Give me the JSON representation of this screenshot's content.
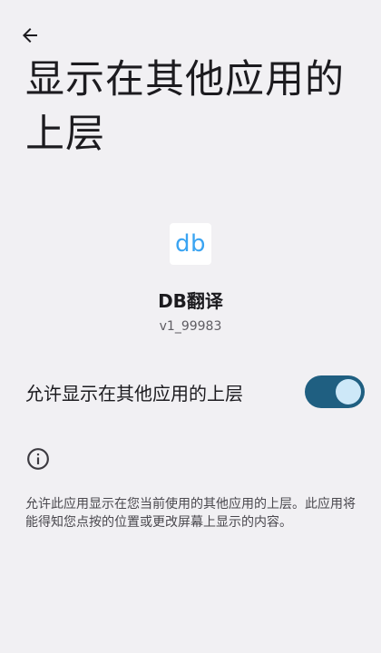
{
  "header": {
    "back_icon": "arrow-back-icon",
    "title": "显示在其他应用的上层"
  },
  "app": {
    "icon_text": "db",
    "name": "DB翻译",
    "version": "v1_99983"
  },
  "permission": {
    "label": "允许显示在其他应用的上层",
    "enabled": true,
    "toggle_color": "#1f5f81"
  },
  "info": {
    "icon": "info-icon",
    "text": "允许此应用显示在您当前使用的其他应用的上层。此应用将能得知您点按的位置或更改屏幕上显示的内容。"
  }
}
